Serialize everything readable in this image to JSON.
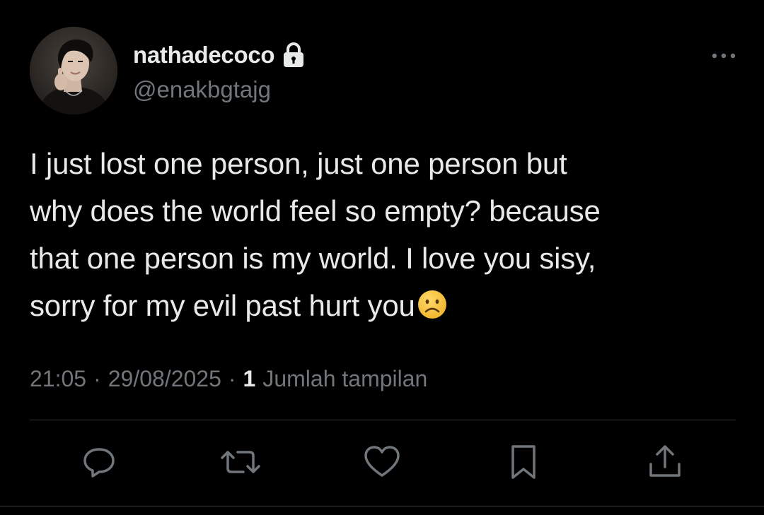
{
  "author": {
    "display_name": "nathadecoco",
    "handle": "@enakbgtajg",
    "protected": true
  },
  "tweet": {
    "text_lines": [
      "I just lost one person, just one person but",
      "why does the world feel so empty? because",
      "that one person is my world. I love you sisy,",
      "sorry for my evil past hurt you"
    ],
    "trailing_emoji": "frowning-face-emoji"
  },
  "meta": {
    "time": "21:05",
    "date": "29/08/2025",
    "views_count": "1",
    "views_label": "Jumlah tampilan",
    "separator": "·"
  },
  "actions": {
    "icons": [
      "reply-icon",
      "retweet-icon",
      "like-icon",
      "bookmark-icon",
      "share-icon"
    ]
  },
  "colors": {
    "background": "#000000",
    "primary_text": "#e7e9ea",
    "secondary_text": "#71767b",
    "divider": "#2f3336",
    "emoji_yellow": "#f8c53a"
  }
}
